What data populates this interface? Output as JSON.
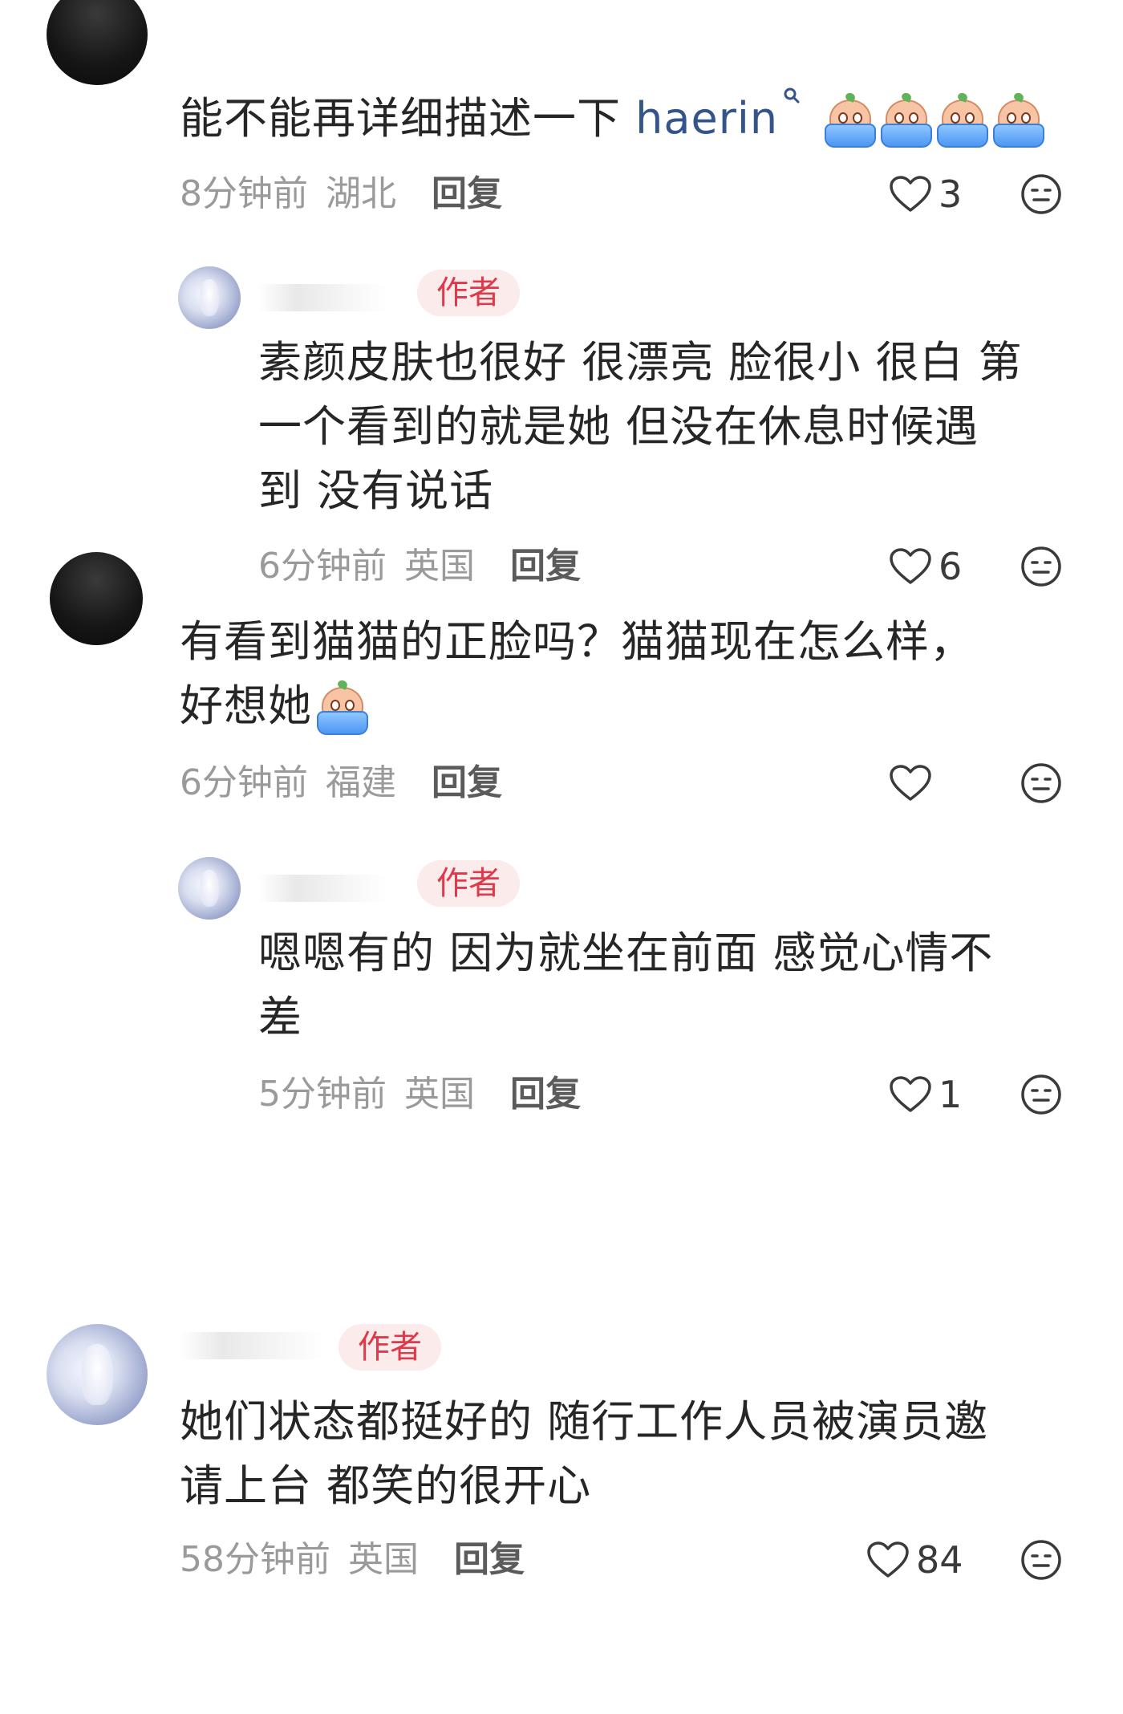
{
  "comments": [
    {
      "text": "能不能再详细描述一下",
      "mention": "haerin",
      "time": "8分钟前",
      "location": "湖北",
      "reply_label": "回复",
      "likes": "3"
    },
    {
      "badge": "作者",
      "lines": [
        "素颜皮肤也很好 很漂亮 脸很小 很白 第",
        "一个看到的就是她 但没在休息时候遇",
        "到 没有说话"
      ],
      "time": "6分钟前",
      "location": "英国",
      "reply_label": "回复",
      "likes": "6"
    },
    {
      "lines": [
        "有看到猫猫的正脸吗？猫猫现在怎么样，",
        "好想她"
      ],
      "time": "6分钟前",
      "location": "福建",
      "reply_label": "回复",
      "likes": ""
    },
    {
      "badge": "作者",
      "lines": [
        "嗯嗯有的 因为就坐在前面 感觉心情不",
        "差"
      ],
      "time": "5分钟前",
      "location": "英国",
      "reply_label": "回复",
      "likes": "1"
    },
    {
      "badge": "作者",
      "lines": [
        "她们状态都挺好的 随行工作人员被演员邀",
        "请上台 都笑的很开心"
      ],
      "time": "58分钟前",
      "location": "英国",
      "reply_label": "回复",
      "likes": "84"
    }
  ],
  "icons": {
    "like": "heart-outline-icon",
    "more": "meh-face-icon",
    "mention": "search-icon",
    "emoji": "crying-peach-in-tub-emoji"
  }
}
